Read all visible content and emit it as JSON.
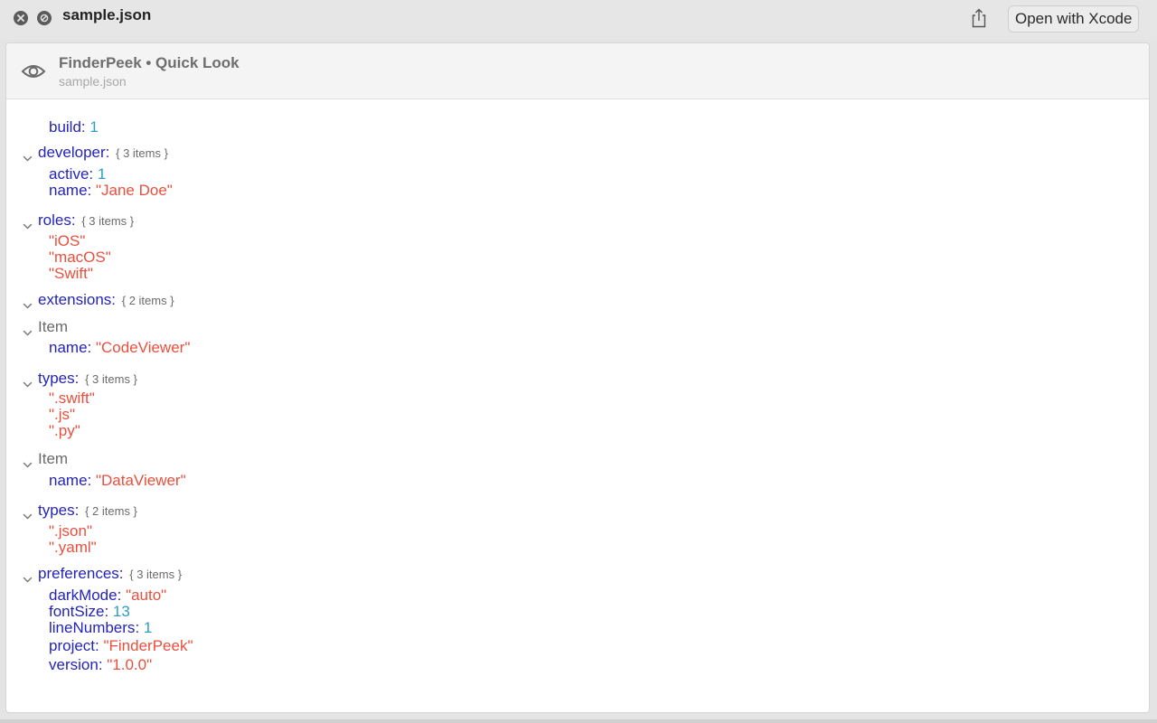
{
  "window": {
    "title": "sample.json",
    "open_button_label": "Open with Xcode"
  },
  "header": {
    "title": "FinderPeek • Quick Look",
    "subtitle": "sample.json"
  },
  "tree": [
    {
      "kind": "kv",
      "indent": 1,
      "key": "build",
      "value": "1",
      "vtype": "num"
    },
    {
      "kind": "group",
      "indent": 0,
      "key": "developer",
      "count": "{ 3 items }"
    },
    {
      "kind": "kv",
      "indent": 1,
      "key": "active",
      "value": "1",
      "vtype": "num"
    },
    {
      "kind": "kv",
      "indent": 1,
      "key": "name",
      "value": "\"Jane Doe\"",
      "vtype": "str"
    },
    {
      "kind": "group",
      "indent": 0,
      "key": "roles",
      "count": "{ 3 items }"
    },
    {
      "kind": "val",
      "indent": 1,
      "value": "\"iOS\"",
      "vtype": "str"
    },
    {
      "kind": "val",
      "indent": 1,
      "value": "\"macOS\"",
      "vtype": "str"
    },
    {
      "kind": "val",
      "indent": 1,
      "value": "\"Swift\"",
      "vtype": "str"
    },
    {
      "kind": "group",
      "indent": 0,
      "key": "extensions",
      "count": "{ 2 items }"
    },
    {
      "kind": "item",
      "indent": 0,
      "label": "Item"
    },
    {
      "kind": "kv",
      "indent": 1,
      "key": "name",
      "value": "\"CodeViewer\"",
      "vtype": "str"
    },
    {
      "kind": "group",
      "indent": 0,
      "key": "types",
      "count": "{ 3 items }"
    },
    {
      "kind": "val",
      "indent": 1,
      "value": "\".swift\"",
      "vtype": "str"
    },
    {
      "kind": "val",
      "indent": 1,
      "value": "\".js\"",
      "vtype": "str"
    },
    {
      "kind": "val",
      "indent": 1,
      "value": "\".py\"",
      "vtype": "str"
    },
    {
      "kind": "item",
      "indent": 0,
      "label": "Item"
    },
    {
      "kind": "kv",
      "indent": 1,
      "key": "name",
      "value": "\"DataViewer\"",
      "vtype": "str"
    },
    {
      "kind": "group",
      "indent": 0,
      "key": "types",
      "count": "{ 2 items }"
    },
    {
      "kind": "val",
      "indent": 1,
      "value": "\".json\"",
      "vtype": "str"
    },
    {
      "kind": "val",
      "indent": 1,
      "value": "\".yaml\"",
      "vtype": "str"
    },
    {
      "kind": "group",
      "indent": 0,
      "key": "preferences",
      "count": "{ 3 items }"
    },
    {
      "kind": "kv",
      "indent": 1,
      "key": "darkMode",
      "value": "\"auto\"",
      "vtype": "str"
    },
    {
      "kind": "kv",
      "indent": 1,
      "key": "fontSize",
      "value": "13",
      "vtype": "num"
    },
    {
      "kind": "kv",
      "indent": 1,
      "key": "lineNumbers",
      "value": "1",
      "vtype": "num"
    },
    {
      "kind": "kv",
      "indent": 1,
      "key": "project",
      "value": "\"FinderPeek\"",
      "vtype": "str"
    },
    {
      "kind": "kv",
      "indent": 1,
      "key": "version",
      "value": "\"1.0.0\"",
      "vtype": "str"
    }
  ]
}
